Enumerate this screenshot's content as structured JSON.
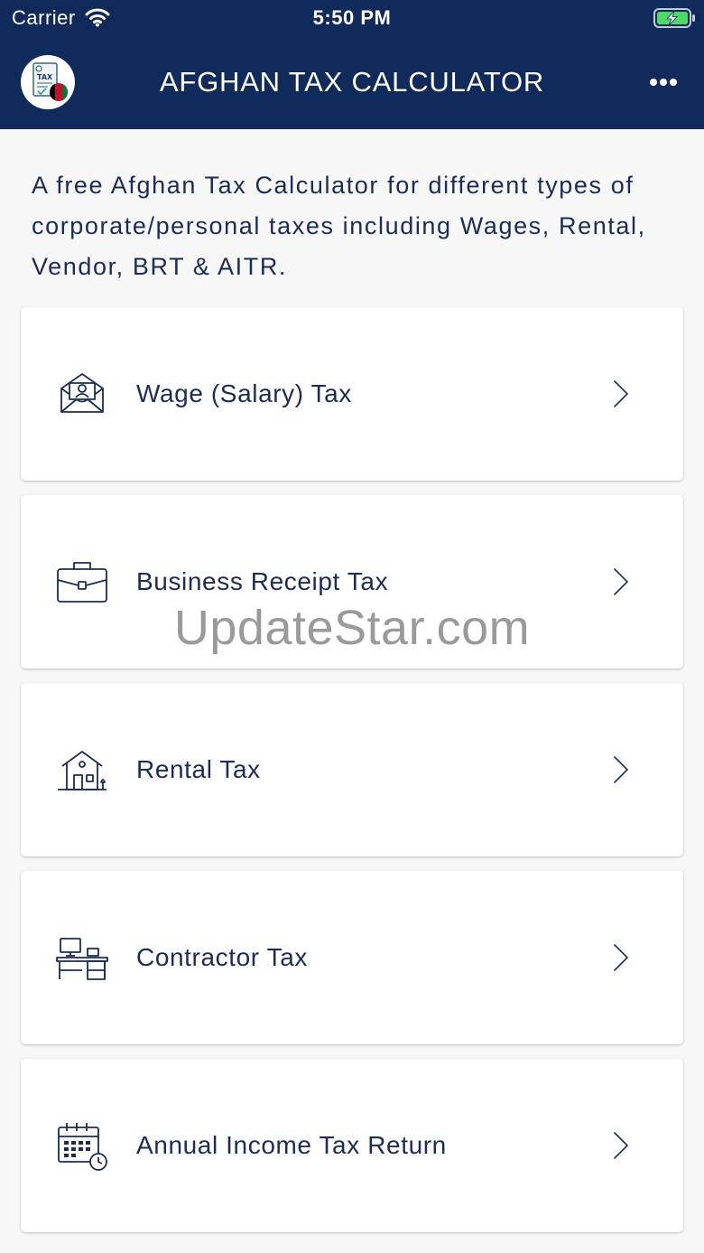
{
  "status_bar": {
    "carrier": "Carrier",
    "time": "5:50 PM",
    "wifi_icon": "wifi-icon",
    "battery_icon": "battery-charging-icon"
  },
  "app_bar": {
    "title": "AFGHAN TAX CALCULATOR",
    "logo_text": "TAX",
    "logo_icon": "tax-document-icon",
    "more_icon": "more-horizontal-icon"
  },
  "intro": "A free Afghan Tax Calculator for different types of corporate/personal taxes including Wages, Rental, Vendor, BRT & AITR.",
  "menu": [
    {
      "label": "Wage (Salary) Tax",
      "icon": "salary-envelope-icon"
    },
    {
      "label": "Business Receipt Tax",
      "icon": "briefcase-icon"
    },
    {
      "label": "Rental Tax",
      "icon": "house-icon"
    },
    {
      "label": "Contractor Tax",
      "icon": "office-desk-icon"
    },
    {
      "label": "Annual Income Tax Return",
      "icon": "calendar-clock-icon"
    }
  ],
  "watermark": "UpdateStar.com",
  "colors": {
    "header_bg": "#102a5c",
    "text": "#1a2c57",
    "page_bg": "#f7f7f8",
    "battery_fill": "#4cd964"
  }
}
